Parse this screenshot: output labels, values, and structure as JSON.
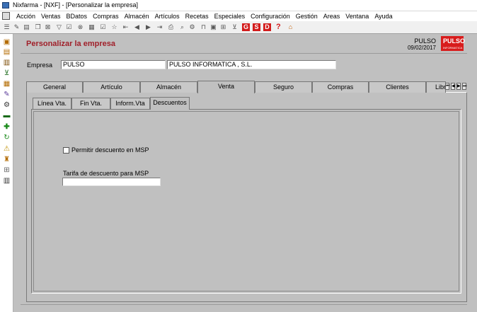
{
  "window": {
    "title": "Nixfarma - [NXF] - [Personalizar la empresa]"
  },
  "menu": [
    "Acción",
    "Ventas",
    "BDatos",
    "Compras",
    "Almacén",
    "Artículos",
    "Recetas",
    "Especiales",
    "Configuración",
    "Gestión",
    "Areas",
    "Ventana",
    "Ayuda"
  ],
  "toolbar": {
    "red_g": "G",
    "red_s": "S",
    "red_d": "D",
    "help": "?"
  },
  "header": {
    "title": "Personalizar la empresa",
    "user": "PULSO",
    "date": "09/02/2017",
    "logo": "PULSO",
    "logo_sub": "INFORMATICA"
  },
  "empresa": {
    "label": "Empresa",
    "code": "PULSO",
    "name": "PULSO INFORMATICA , S.L."
  },
  "tabs": [
    "General",
    "Artículo",
    "Almacén",
    "Venta",
    "Seguro",
    "Compras",
    "Clientes",
    "Libr"
  ],
  "subtabs": [
    "Línea Vta.",
    "Fin Vta.",
    "Inform.Vta",
    "Descuentos"
  ],
  "descuentos": {
    "checkbox_label": "Permitir descuento en MSP",
    "tarifa_label": "Tarifa de descuento para MSP",
    "tarifa_value": ""
  }
}
